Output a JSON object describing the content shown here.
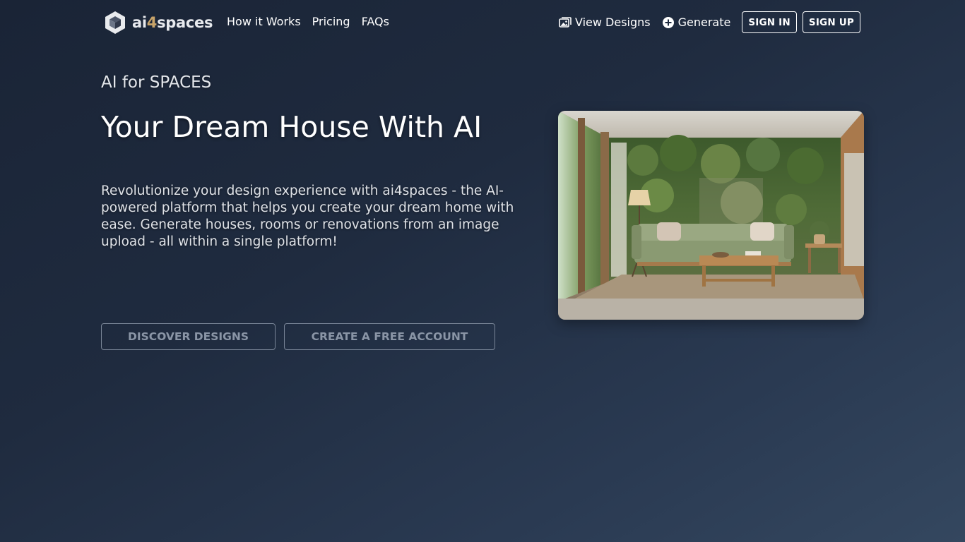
{
  "brand": {
    "name_prefix": "ai",
    "name_mid": "4",
    "name_suffix": "spaces"
  },
  "nav": {
    "links": [
      {
        "label": "How it Works"
      },
      {
        "label": "Pricing"
      },
      {
        "label": "FAQs"
      }
    ],
    "view_designs": {
      "label": "View Designs",
      "icon": "images-icon"
    },
    "generate": {
      "label": "Generate",
      "icon": "plus-circle-icon"
    },
    "sign_in": "SIGN IN",
    "sign_up": "SIGN UP"
  },
  "hero": {
    "eyebrow": "AI for SPACES",
    "title": "Your Dream House With AI",
    "description": "Revolutionize your design experience with ai4spaces - the AI-powered platform that helps you create your dream home with ease. Generate houses, rooms or renovations from an image upload - all within a single platform!",
    "discover_button": "DISCOVER DESIGNS",
    "create_button": "CREATE A FREE ACCOUNT"
  },
  "colors": {
    "background_start": "#1a2436",
    "background_end": "#34475f",
    "brand_accent": "#c8a46a",
    "cta_border": "#7a8698"
  }
}
